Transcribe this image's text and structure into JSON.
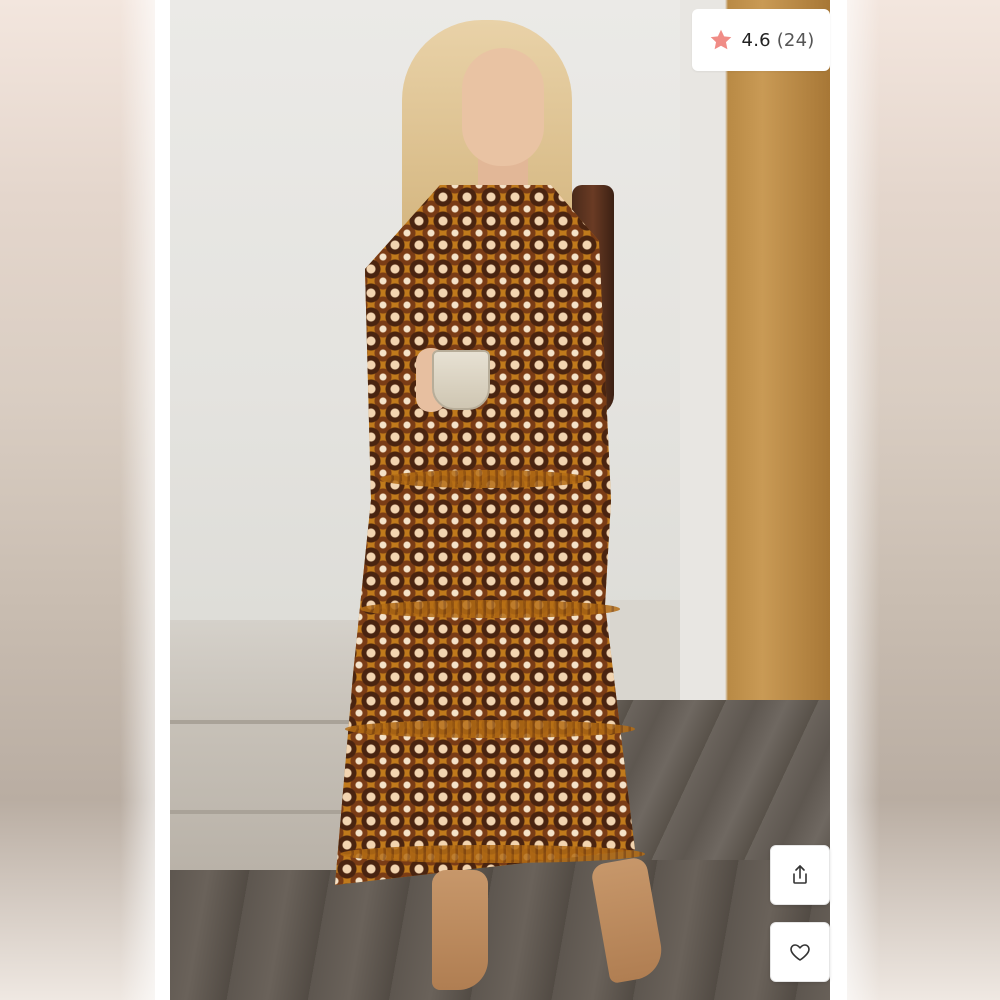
{
  "listing_image": {
    "alt_description": ""
  },
  "rating": {
    "score": "4.6",
    "count": "(24)",
    "icon": "star-icon",
    "star_color": "#f08c86"
  },
  "actions": {
    "share_icon": "share-icon",
    "like_icon": "heart-icon"
  },
  "colors": {
    "dress_primary": "#c07a1c",
    "dress_pattern_dark": "#4a2410",
    "dress_pattern_light": "#f2d4b0"
  }
}
